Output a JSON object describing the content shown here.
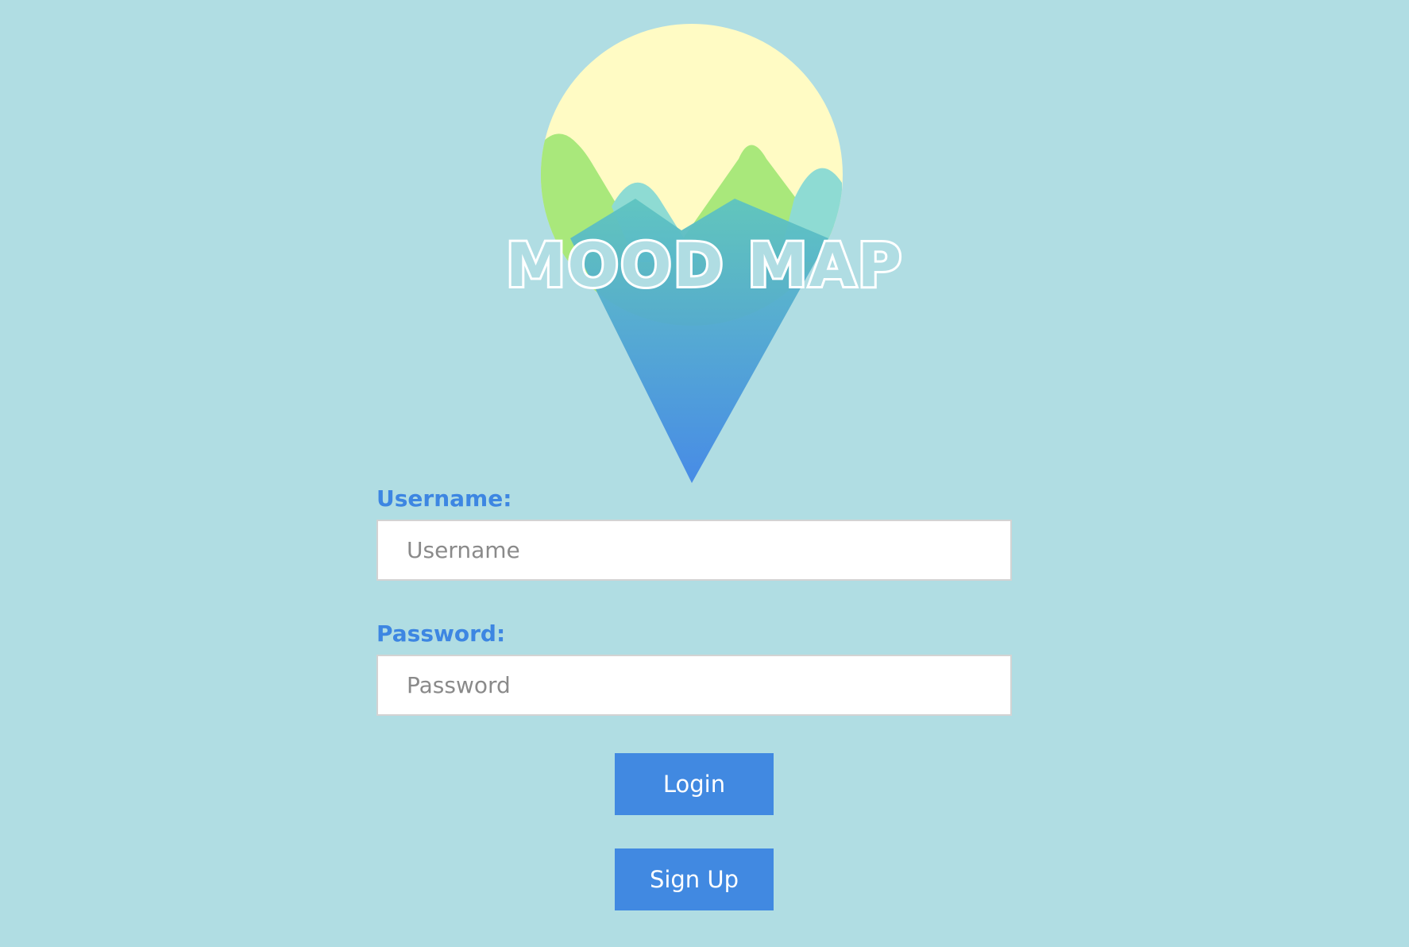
{
  "logo": {
    "title": "MOOD MAP",
    "icon": "map-pin-mountains-logo",
    "colors": {
      "sun": "#fffbc4",
      "mountain_green": "#a9e87b",
      "mountain_teal": "#8edbd3",
      "pin_top": "#5ec4c0",
      "pin_bottom": "#4287e6"
    }
  },
  "form": {
    "username": {
      "label": "Username:",
      "placeholder": "Username",
      "value": ""
    },
    "password": {
      "label": "Password:",
      "placeholder": "Password",
      "value": ""
    }
  },
  "buttons": {
    "login_label": "Login",
    "signup_label": "Sign Up"
  },
  "theme": {
    "background": "#b0dde3",
    "accent": "#4189e1",
    "label_color": "#3d86e2"
  }
}
